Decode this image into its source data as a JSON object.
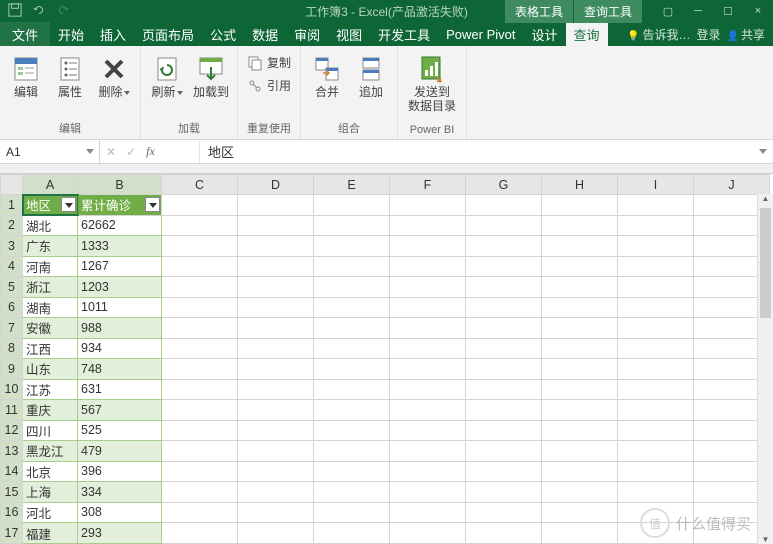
{
  "titlebar": {
    "title": "工作簿3 - Excel(产品激活失败)",
    "tool_tabs": [
      "表格工具",
      "查询工具"
    ],
    "ctrls": {
      "min": "─",
      "max": "☐",
      "close": "×",
      "ribbon": "▢"
    }
  },
  "tabs": {
    "items": [
      "文件",
      "开始",
      "插入",
      "页面布局",
      "公式",
      "数据",
      "审阅",
      "视图",
      "开发工具",
      "Power Pivot",
      "设计",
      "查询"
    ],
    "active": "查询",
    "tell_me": "告诉我…",
    "login": "登录",
    "share": "共享"
  },
  "ribbon": {
    "groups": [
      {
        "label": "编辑",
        "big": [
          {
            "name": "edit",
            "lbl": "编辑"
          },
          {
            "name": "properties",
            "lbl": "属性"
          },
          {
            "name": "delete",
            "lbl": "删除",
            "drop": true
          }
        ]
      },
      {
        "label": "加载",
        "big": [
          {
            "name": "refresh",
            "lbl": "刷新",
            "drop": true
          },
          {
            "name": "loadto",
            "lbl": "加载到"
          }
        ]
      },
      {
        "label": "重复使用",
        "small": [
          {
            "name": "duplicate",
            "lbl": "复制"
          },
          {
            "name": "reference",
            "lbl": "引用"
          }
        ]
      },
      {
        "label": "组合",
        "big": [
          {
            "name": "merge",
            "lbl": "合并"
          },
          {
            "name": "append",
            "lbl": "追加"
          }
        ]
      },
      {
        "label": "Power BI",
        "big": [
          {
            "name": "send-catalog",
            "lbl": "发送到\n数据目录"
          }
        ]
      }
    ]
  },
  "formula_bar": {
    "name_box": "A1",
    "formula": "地区"
  },
  "grid": {
    "columns": [
      "A",
      "B",
      "C",
      "D",
      "E",
      "F",
      "G",
      "H",
      "I",
      "J"
    ],
    "headers": [
      "地区",
      "累计确诊"
    ],
    "rows": [
      [
        "湖北",
        "62662"
      ],
      [
        "广东",
        "1333"
      ],
      [
        "河南",
        "1267"
      ],
      [
        "浙江",
        "1203"
      ],
      [
        "湖南",
        "1011"
      ],
      [
        "安徽",
        "988"
      ],
      [
        "江西",
        "934"
      ],
      [
        "山东",
        "748"
      ],
      [
        "江苏",
        "631"
      ],
      [
        "重庆",
        "567"
      ],
      [
        "四川",
        "525"
      ],
      [
        "黑龙江",
        "479"
      ],
      [
        "北京",
        "396"
      ],
      [
        "上海",
        "334"
      ],
      [
        "河北",
        "308"
      ],
      [
        "福建",
        "293"
      ]
    ]
  },
  "watermark": {
    "logo": "值",
    "text": "什么值得买"
  }
}
